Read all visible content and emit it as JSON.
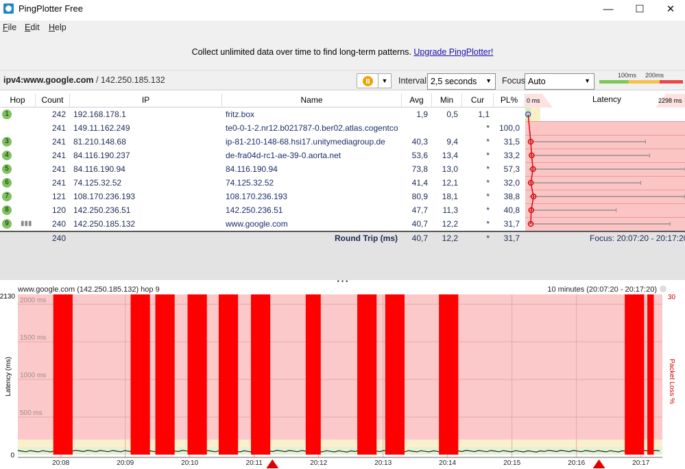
{
  "window": {
    "title": "PingPlotter Free",
    "min": "—",
    "max": "☐",
    "close": "✕"
  },
  "menu": [
    "File",
    "Edit",
    "Help"
  ],
  "promo": {
    "text": "Collect unlimited data over time to find long-term patterns.",
    "link": "Upgrade PingPlotter!"
  },
  "target": {
    "host": "ipv4:www.google.com",
    "sep": " / ",
    "ip": "142.250.185.132"
  },
  "controls": {
    "interval_label": "Interval",
    "interval_value": "2,5 seconds",
    "focus_label": "Focus",
    "focus_value": "Auto"
  },
  "scale": {
    "t1": "100ms",
    "t2": "200ms"
  },
  "columns": {
    "hop": "Hop",
    "count": "Count",
    "ip": "IP",
    "name": "Name",
    "avg": "Avg",
    "min": "Min",
    "cur": "Cur",
    "pl": "PL%",
    "lat0": "0 ms",
    "latency": "Latency",
    "latmax": "2298 ms"
  },
  "hops": [
    {
      "hop": "1",
      "count": "242",
      "ip": "192.168.178.1",
      "name": "fritz.box",
      "avg": "1,9",
      "min": "0,5",
      "cur": "1,1",
      "pl": "",
      "lat_min": 0.5,
      "lat_avg": 1.9,
      "lat_max": 0,
      "status": "ok"
    },
    {
      "hop": "",
      "count": "241",
      "ip": "149.11.162.249",
      "name": "te0-0-1-2.nr12.b021787-0.ber02.atlas.cogentco.",
      "avg": "",
      "min": "",
      "cur": "*",
      "pl": "100,0",
      "lat_min": 0,
      "lat_avg": 0,
      "lat_max": 0,
      "status": "lost"
    },
    {
      "hop": "3",
      "count": "241",
      "ip": "81.210.148.68",
      "name": "ip-81-210-148-68.hsi17.unitymediagroup.de",
      "avg": "40,3",
      "min": "9,4",
      "cur": "*",
      "pl": "31,5",
      "lat_min": 9.4,
      "lat_avg": 40.3,
      "lat_max": 1720,
      "status": "loss"
    },
    {
      "hop": "4",
      "count": "241",
      "ip": "84.116.190.237",
      "name": "de-fra04d-rc1-ae-39-0.aorta.net",
      "avg": "53,6",
      "min": "13,4",
      "cur": "*",
      "pl": "33,2",
      "lat_min": 13.4,
      "lat_avg": 53.6,
      "lat_max": 1780,
      "status": "loss"
    },
    {
      "hop": "5",
      "count": "241",
      "ip": "84.116.190.94",
      "name": "84.116.190.94",
      "avg": "73,8",
      "min": "13,0",
      "cur": "*",
      "pl": "57,3",
      "lat_min": 13.0,
      "lat_avg": 73.8,
      "lat_max": 2298,
      "status": "loss"
    },
    {
      "hop": "6",
      "count": "241",
      "ip": "74.125.32.52",
      "name": "74.125.32.52",
      "avg": "41,4",
      "min": "12,1",
      "cur": "*",
      "pl": "32,0",
      "lat_min": 12.1,
      "lat_avg": 41.4,
      "lat_max": 1650,
      "status": "loss"
    },
    {
      "hop": "7",
      "count": "121",
      "ip": "108.170.236.193",
      "name": "108.170.236.193",
      "avg": "80,9",
      "min": "18,1",
      "cur": "*",
      "pl": "38,8",
      "lat_min": 18.1,
      "lat_avg": 80.9,
      "lat_max": 2290,
      "status": "loss"
    },
    {
      "hop": "8",
      "count": "120",
      "ip": "142.250.236.51",
      "name": "142.250.236.51",
      "avg": "47,7",
      "min": "11,3",
      "cur": "*",
      "pl": "40,8",
      "lat_min": 11.3,
      "lat_avg": 47.7,
      "lat_max": 1290,
      "status": "loss"
    },
    {
      "hop": "9",
      "count": "240",
      "ip": "142.250.185.132",
      "name": "www.google.com",
      "avg": "40,7",
      "min": "12,2",
      "cur": "*",
      "pl": "31,7",
      "lat_min": 12.2,
      "lat_avg": 40.7,
      "lat_max": 2080,
      "status": "loss"
    }
  ],
  "summary": {
    "count": "240",
    "label": "Round Trip (ms)",
    "avg": "40,7",
    "min": "12,2",
    "cur": "*",
    "pl": "31,7",
    "focus": "Focus: 20:07:20 - 20:17:20"
  },
  "bottom": {
    "title": "www.google.com (142.250.185.132) hop 9",
    "range": "10 minutes (20:07:20 - 20:17:20)",
    "ymax": "2130",
    "ylabel": "Latency (ms)",
    "y2label": "Packet Loss %",
    "y2max": "30",
    "y_ticks": [
      "2000 ms",
      "1500 ms",
      "1000 ms",
      "500 ms",
      "0"
    ],
    "x_ticks": [
      "20:08",
      "20:09",
      "20:10",
      "20:11",
      "20:12",
      "20:13",
      "20:14",
      "20:15",
      "20:16",
      "20:17"
    ]
  },
  "chart_data": {
    "type": "bar",
    "title": "www.google.com (142.250.185.132) hop 9",
    "xlabel": "",
    "ylabel": "Latency (ms)",
    "y2label": "Packet Loss %",
    "ylim": [
      0,
      2130
    ],
    "x_ticks": [
      "20:08",
      "20:09",
      "20:10",
      "20:11",
      "20:12",
      "20:13",
      "20:14",
      "20:15",
      "20:16",
      "20:17"
    ],
    "loss_periods": [
      {
        "start": "20:07:53",
        "end": "20:08:11"
      },
      {
        "start": "20:09:05",
        "end": "20:09:23"
      },
      {
        "start": "20:09:28",
        "end": "20:09:46"
      },
      {
        "start": "20:09:58",
        "end": "20:10:16"
      },
      {
        "start": "20:10:27",
        "end": "20:10:45"
      },
      {
        "start": "20:10:57",
        "end": "20:11:15"
      },
      {
        "start": "20:11:48",
        "end": "20:12:02"
      },
      {
        "start": "20:12:36",
        "end": "20:12:54"
      },
      {
        "start": "20:13:02",
        "end": "20:13:20"
      },
      {
        "start": "20:13:52",
        "end": "20:14:10"
      },
      {
        "start": "20:16:45",
        "end": "20:17:03"
      },
      {
        "start": "20:17:06",
        "end": "20:17:12"
      }
    ],
    "markers": [
      "20:11:17",
      "20:16:21"
    ],
    "grid": true
  }
}
